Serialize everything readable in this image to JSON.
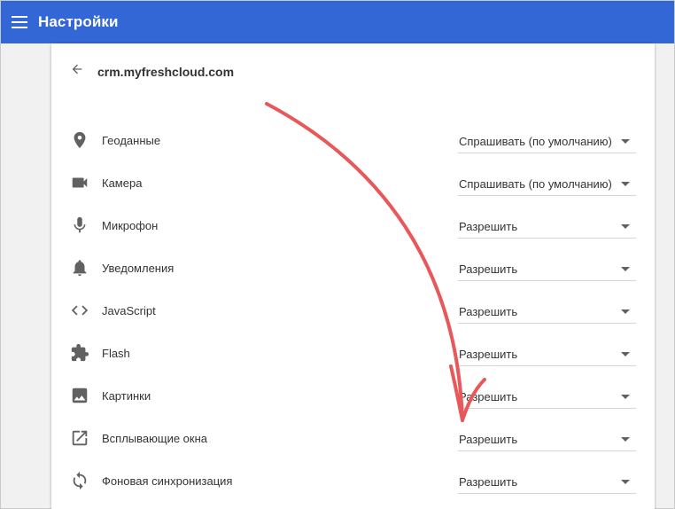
{
  "header": {
    "title": "Настройки",
    "menu_icon": "hamburger-menu-icon"
  },
  "site": {
    "name": "crm.myfreshcloud.com",
    "back_icon": "arrow-back-icon"
  },
  "permissions": [
    {
      "label": "Геоданные",
      "value": "Спрашивать (по умолчанию)",
      "icon": "location-pin-icon"
    },
    {
      "label": "Камера",
      "value": "Спрашивать (по умолчанию)",
      "icon": "camera-icon"
    },
    {
      "label": "Микрофон",
      "value": "Разрешить",
      "icon": "microphone-icon"
    },
    {
      "label": "Уведомления",
      "value": "Разрешить",
      "icon": "bell-icon"
    },
    {
      "label": "JavaScript",
      "value": "Разрешить",
      "icon": "code-icon"
    },
    {
      "label": "Flash",
      "value": "Разрешить",
      "icon": "puzzle-icon"
    },
    {
      "label": "Картинки",
      "value": "Разрешить",
      "icon": "image-icon"
    },
    {
      "label": "Всплывающие окна",
      "value": "Разрешить",
      "icon": "open-in-new-icon"
    },
    {
      "label": "Фоновая синхронизация",
      "value": "Разрешить",
      "icon": "sync-icon"
    }
  ],
  "annotation": {
    "type": "red-arrow",
    "color": "#e8585a"
  },
  "colors": {
    "topbar": "#3367d6",
    "icon": "#616161"
  }
}
